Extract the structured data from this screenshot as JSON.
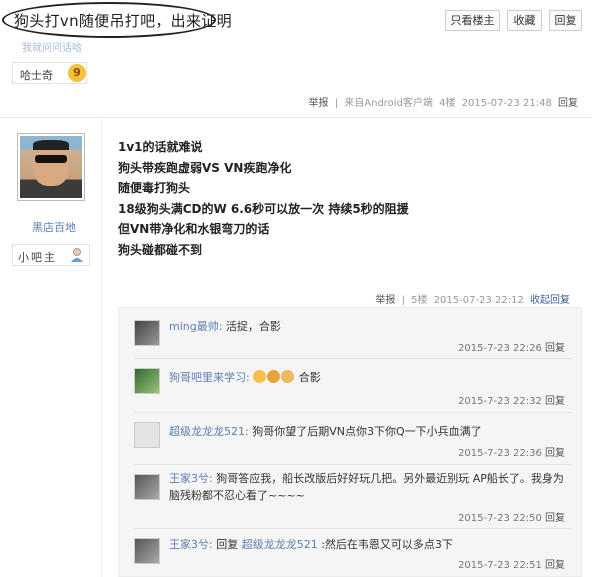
{
  "header": {
    "title": "狗头打vn随便吊打吧，出来证明",
    "buttons": [
      "只看楼主",
      "收藏",
      "回复"
    ]
  },
  "post1": {
    "prev_author_fragment": "我就问问话哈",
    "badge": "哈士奇",
    "badge_level": "9",
    "meta": {
      "report": "举报",
      "via": "来自Android客户端",
      "floor": "4楼",
      "time": "2015-07-23 21:48",
      "reply": "回复"
    }
  },
  "post2": {
    "author": "黑店百地",
    "badge": "小吧主",
    "lines": [
      "1v1的话就难说",
      "狗头带疾跑虚弱VS VN疾跑净化",
      "随便毒打狗头",
      "18级狗头满CD的W 6.6秒可以放一次 持续5秒的阻援",
      "但VN带净化和水银弯刀的话",
      "狗头碰都碰不到"
    ],
    "meta": {
      "report": "举报",
      "floor": "5楼",
      "time": "2015-07-23 22:12",
      "collapse": "收起回复"
    }
  },
  "replies": [
    {
      "name": "ming最帅:",
      "text": " 活捉，合影",
      "time": "2015-7-23 22:26",
      "reply": "回复"
    },
    {
      "name": "狗哥吧里来学习:",
      "text": " 合影",
      "emojis": [
        "peace-emoji",
        "smile-emoji",
        "thumbs-emoji"
      ],
      "time": "2015-7-23 22:32",
      "reply": "回复"
    },
    {
      "name": "超级龙龙龙521:",
      "text": " 狗哥你望了后期VN点你3下你Q一下小兵血满了",
      "time": "2015-7-23 22:36",
      "reply": "回复"
    },
    {
      "name": "王家3兮:",
      "text": " 狗哥答应我，船长改版后好好玩几把。另外最近别玩 AP船长了。我身为",
      "text2": "脑残粉都不忍心看了~~~~",
      "time": "2015-7-23 22:50",
      "reply": "回复"
    },
    {
      "name": "王家3兮:",
      "text_prefix": " 回复 ",
      "target": "超级龙龙龙521",
      "text": " :然后在韦恩又可以多点3下",
      "time": "2015-7-23 22:51",
      "reply": "回复"
    }
  ],
  "colors": {
    "link": "#5b7fb3",
    "accent": "#3d5e93",
    "meta": "#999999"
  }
}
